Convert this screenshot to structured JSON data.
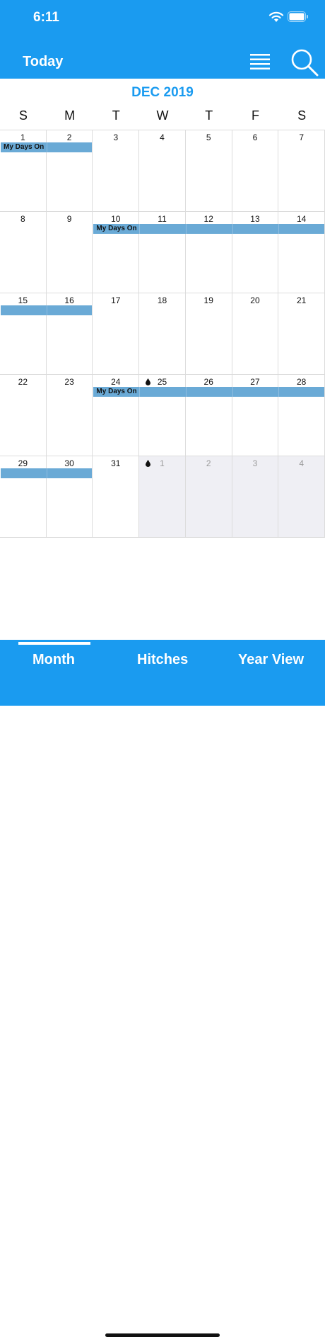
{
  "status": {
    "time": "6:11"
  },
  "navbar": {
    "today_label": "Today"
  },
  "calendar": {
    "month_title": "DEC 2019",
    "weekdays": [
      "S",
      "M",
      "T",
      "W",
      "T",
      "F",
      "S"
    ],
    "weeks": [
      [
        {
          "n": "1"
        },
        {
          "n": "2"
        },
        {
          "n": "3"
        },
        {
          "n": "4"
        },
        {
          "n": "5"
        },
        {
          "n": "6"
        },
        {
          "n": "7"
        }
      ],
      [
        {
          "n": "8"
        },
        {
          "n": "9"
        },
        {
          "n": "10"
        },
        {
          "n": "11"
        },
        {
          "n": "12"
        },
        {
          "n": "13"
        },
        {
          "n": "14"
        }
      ],
      [
        {
          "n": "15"
        },
        {
          "n": "16"
        },
        {
          "n": "17"
        },
        {
          "n": "18"
        },
        {
          "n": "19"
        },
        {
          "n": "20"
        },
        {
          "n": "21"
        }
      ],
      [
        {
          "n": "22"
        },
        {
          "n": "23"
        },
        {
          "n": "24"
        },
        {
          "n": "25",
          "drop": true
        },
        {
          "n": "26"
        },
        {
          "n": "27"
        },
        {
          "n": "28"
        }
      ],
      [
        {
          "n": "29"
        },
        {
          "n": "30"
        },
        {
          "n": "31"
        },
        {
          "n": "1",
          "other": true,
          "drop": true
        },
        {
          "n": "2",
          "other": true
        },
        {
          "n": "3",
          "other": true
        },
        {
          "n": "4",
          "other": true
        }
      ]
    ],
    "events": [
      {
        "week": 0,
        "start": 0,
        "end": 1,
        "label": "My Days On"
      },
      {
        "week": 1,
        "start": 2,
        "end": 6,
        "label": "My Days On"
      },
      {
        "week": 2,
        "start": 0,
        "end": 1,
        "label": ""
      },
      {
        "week": 3,
        "start": 2,
        "end": 6,
        "label": "My Days On"
      },
      {
        "week": 4,
        "start": 0,
        "end": 1,
        "label": ""
      }
    ]
  },
  "tabs": {
    "month": "Month",
    "hitches": "Hitches",
    "year_view": "Year View"
  },
  "colors": {
    "accent": "#1a9bf0",
    "event": "#6aaad6"
  }
}
